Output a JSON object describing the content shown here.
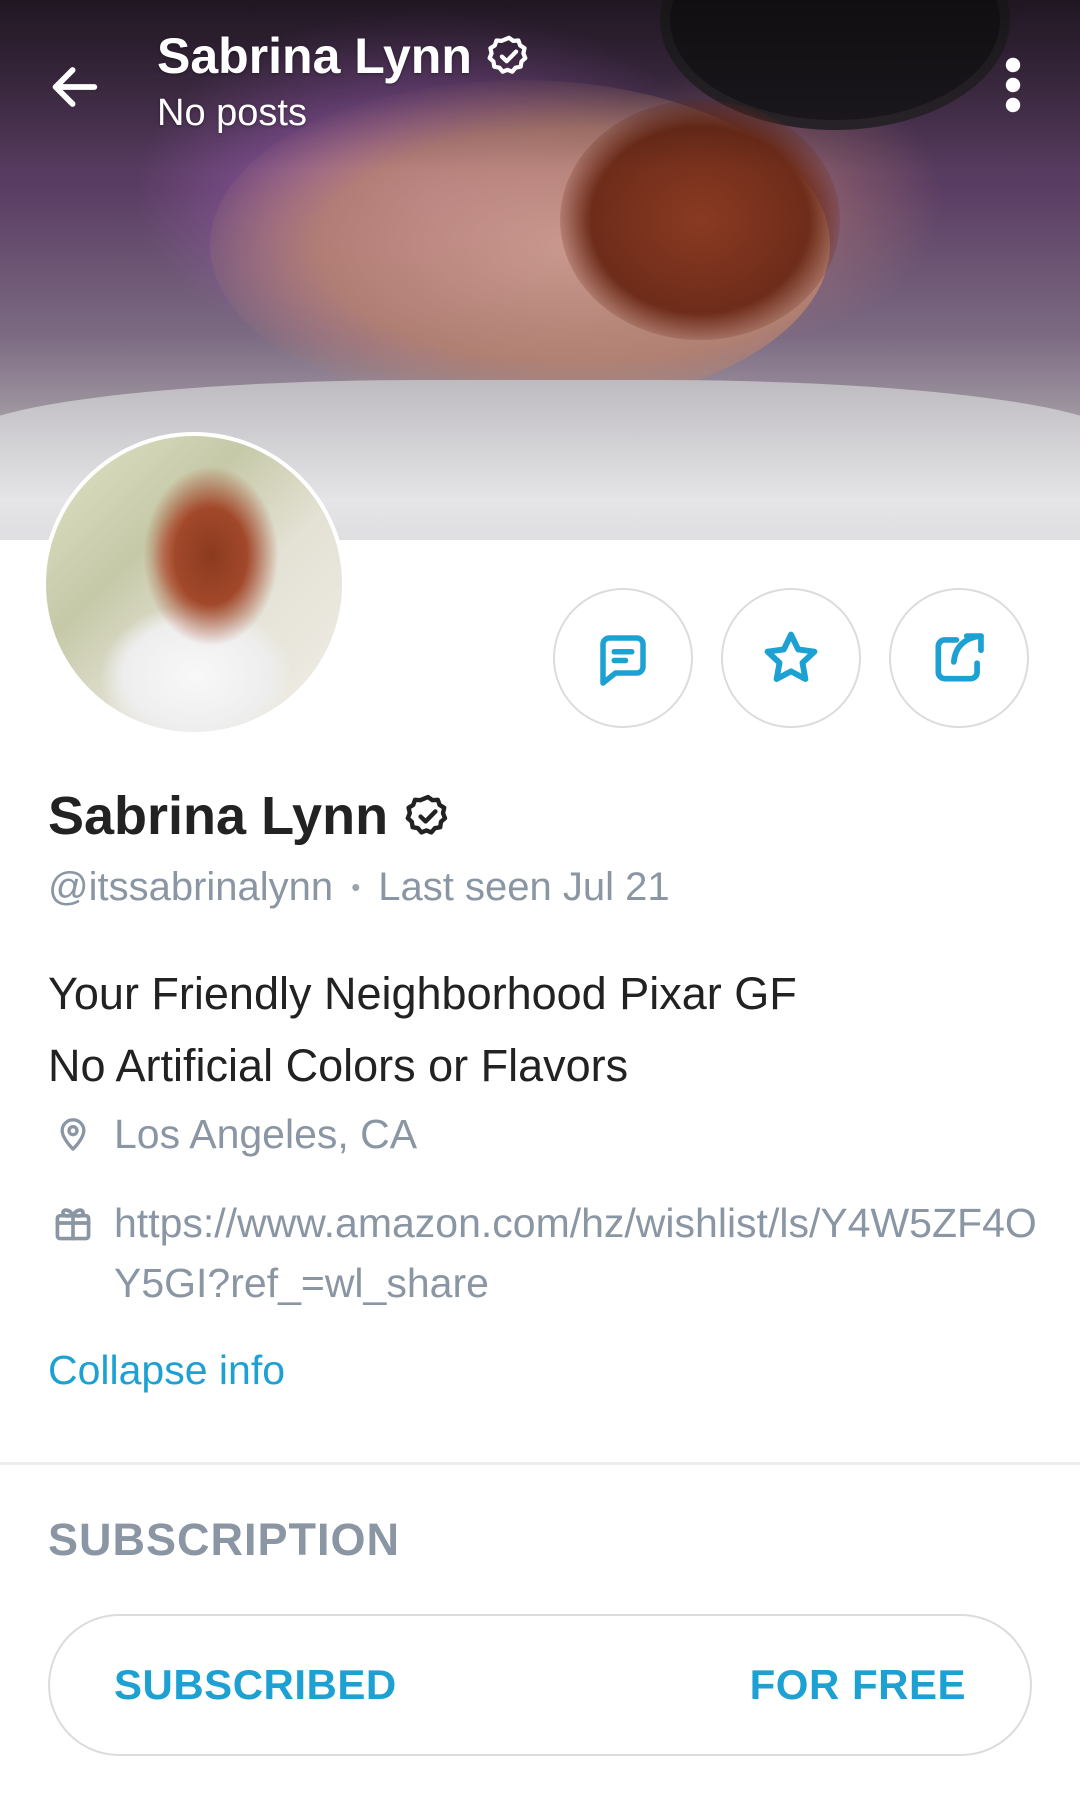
{
  "header": {
    "name": "Sabrina Lynn",
    "subtitle": "No posts"
  },
  "profile": {
    "name": "Sabrina Lynn",
    "handle": "@itssabrinalynn",
    "separator": "•",
    "last_seen": "Last seen Jul 21",
    "bio_lines": [
      "Your Friendly Neighborhood Pixar GF",
      "No Artificial Colors or Flavors"
    ],
    "location": "Los Angeles, CA",
    "wishlist_url": "https://www.amazon.com/hz/wishlist/ls/Y4W5ZF4OY5GI?ref_=wl_share",
    "collapse_label": "Collapse info"
  },
  "subscription": {
    "heading": "SUBSCRIPTION",
    "status": "SUBSCRIBED",
    "price": "FOR FREE"
  },
  "icons": {
    "back": "arrow-left-icon",
    "verified": "verified-badge-icon",
    "more": "more-vertical-icon",
    "message": "message-icon",
    "favorite": "star-icon",
    "share": "share-icon",
    "location": "location-pin-icon",
    "gift": "gift-icon"
  },
  "colors": {
    "accent": "#1da1d3",
    "muted": "#8a96a3",
    "text": "#222222"
  }
}
